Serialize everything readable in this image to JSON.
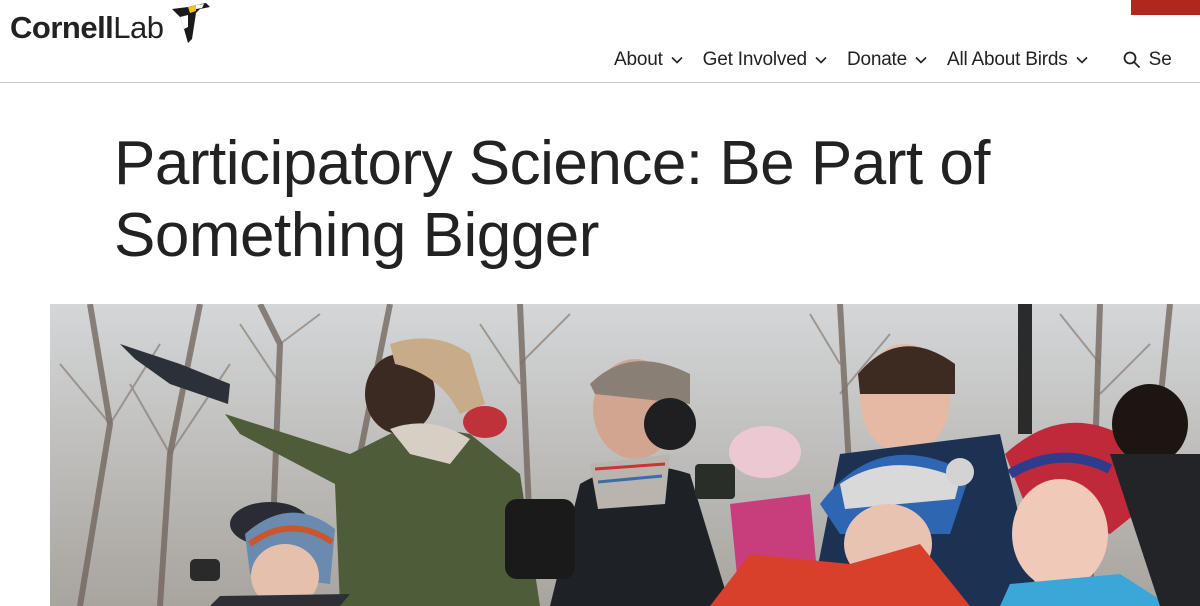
{
  "logo": {
    "text_bold": "Cornell",
    "text_light": "Lab",
    "icon": "woodpecker-logo-icon"
  },
  "nav": {
    "items": [
      {
        "label": "About",
        "icon": "chevron-down-icon"
      },
      {
        "label": "Get Involved",
        "icon": "chevron-down-icon"
      },
      {
        "label": "Donate",
        "icon": "chevron-down-icon"
      },
      {
        "label": "All About Birds",
        "icon": "chevron-down-icon"
      }
    ],
    "search_label": "Se",
    "search_icon": "search-icon"
  },
  "page": {
    "title": "Participatory Science: Be Part of Something Bigger"
  },
  "colors": {
    "accent_red": "#b3261e",
    "text": "#222222",
    "divider": "#c8c8c8"
  }
}
